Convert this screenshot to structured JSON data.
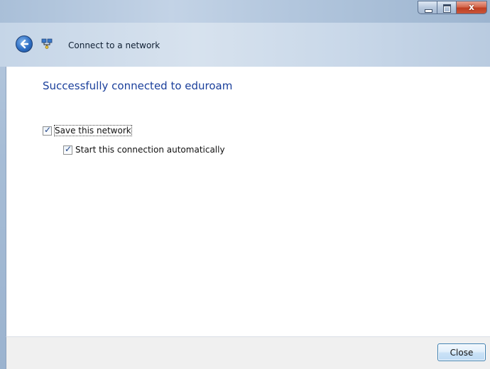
{
  "window": {
    "title": "Connect to a network",
    "caption_buttons": {
      "minimize": "minimize",
      "maximize": "maximize",
      "close": "x"
    }
  },
  "main": {
    "status_text": "Successfully connected to eduroam",
    "options": [
      {
        "label": "Save this network",
        "checked": true
      },
      {
        "label": "Start this connection automatically",
        "checked": true
      }
    ]
  },
  "footer": {
    "close_label": "Close"
  },
  "icons": {
    "back": "back-arrow-icon",
    "network": "network-icon"
  }
}
